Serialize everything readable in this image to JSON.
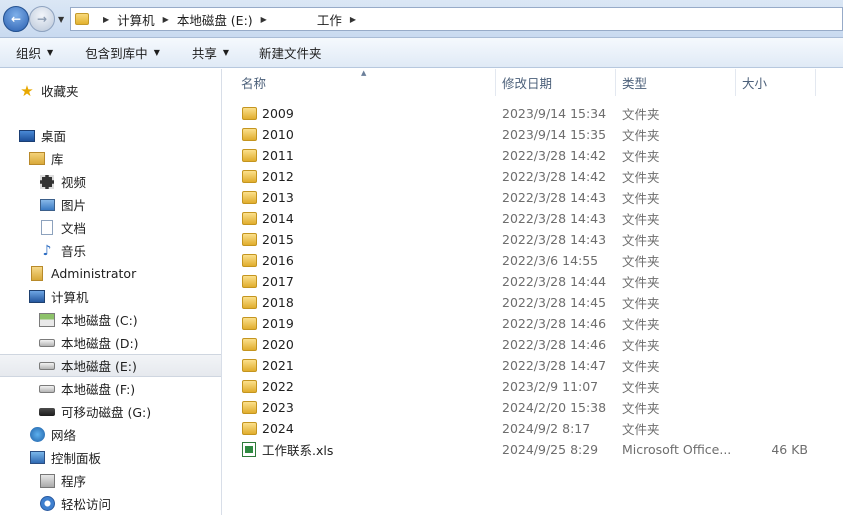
{
  "address": {
    "crumbs": [
      "计算机",
      "本地磁盘 (E:)",
      "工作"
    ]
  },
  "toolbar": {
    "organize": "组织",
    "include_in_library": "包含到库中",
    "share": "共享",
    "new_folder": "新建文件夹"
  },
  "sidebar": {
    "favorites": "收藏夹",
    "desktop": "桌面",
    "libraries": "库",
    "videos": "视频",
    "pictures": "图片",
    "documents": "文档",
    "music": "音乐",
    "user": "Administrator",
    "computer": "计算机",
    "drive_c": "本地磁盘 (C:)",
    "drive_d": "本地磁盘 (D:)",
    "drive_e": "本地磁盘 (E:)",
    "drive_f": "本地磁盘 (F:)",
    "drive_g": "可移动磁盘 (G:)",
    "network": "网络",
    "control_panel": "控制面板",
    "programs": "程序",
    "ease_of_access": "轻松访问"
  },
  "columns": {
    "name": "名称",
    "date": "修改日期",
    "type": "类型",
    "size": "大小"
  },
  "files": [
    {
      "name": "2009",
      "date": "2023/9/14 15:34",
      "type": "文件夹",
      "size": ""
    },
    {
      "name": "2010",
      "date": "2023/9/14 15:35",
      "type": "文件夹",
      "size": ""
    },
    {
      "name": "2011",
      "date": "2022/3/28 14:42",
      "type": "文件夹",
      "size": ""
    },
    {
      "name": "2012",
      "date": "2022/3/28 14:42",
      "type": "文件夹",
      "size": ""
    },
    {
      "name": "2013",
      "date": "2022/3/28 14:43",
      "type": "文件夹",
      "size": ""
    },
    {
      "name": "2014",
      "date": "2022/3/28 14:43",
      "type": "文件夹",
      "size": ""
    },
    {
      "name": "2015",
      "date": "2022/3/28 14:43",
      "type": "文件夹",
      "size": ""
    },
    {
      "name": "2016",
      "date": "2022/3/6 14:55",
      "type": "文件夹",
      "size": ""
    },
    {
      "name": "2017",
      "date": "2022/3/28 14:44",
      "type": "文件夹",
      "size": ""
    },
    {
      "name": "2018",
      "date": "2022/3/28 14:45",
      "type": "文件夹",
      "size": ""
    },
    {
      "name": "2019",
      "date": "2022/3/28 14:46",
      "type": "文件夹",
      "size": ""
    },
    {
      "name": "2020",
      "date": "2022/3/28 14:46",
      "type": "文件夹",
      "size": ""
    },
    {
      "name": "2021",
      "date": "2022/3/28 14:47",
      "type": "文件夹",
      "size": ""
    },
    {
      "name": "2022",
      "date": "2023/2/9 11:07",
      "type": "文件夹",
      "size": ""
    },
    {
      "name": "2023",
      "date": "2024/2/20 15:38",
      "type": "文件夹",
      "size": ""
    },
    {
      "name": "2024",
      "date": "2024/9/2 8:17",
      "type": "文件夹",
      "size": ""
    },
    {
      "name": "工作联系.xls",
      "date": "2024/9/25 8:29",
      "type": "Microsoft Office...",
      "size": "46 KB"
    }
  ]
}
